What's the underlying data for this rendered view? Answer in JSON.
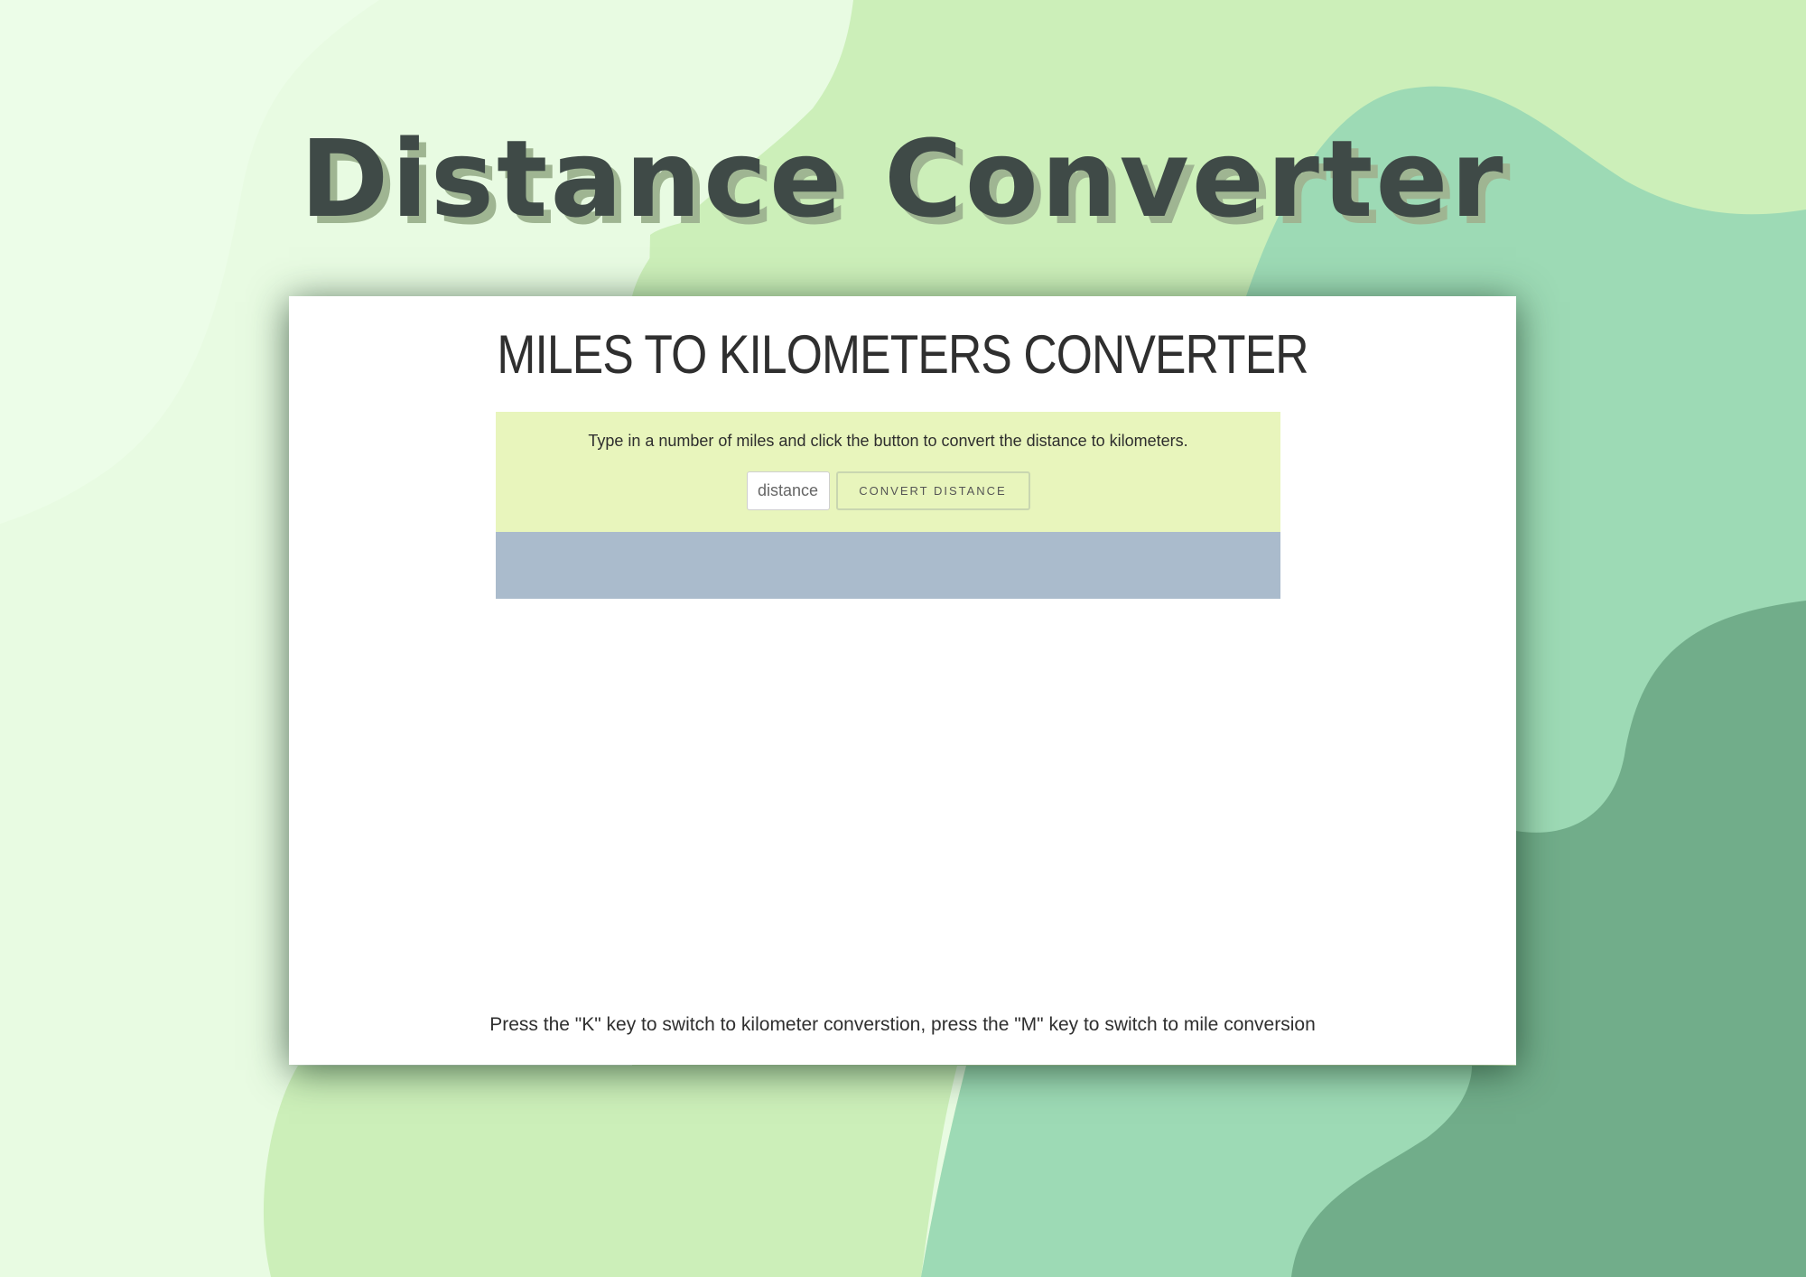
{
  "hero": {
    "title": "Distance Converter"
  },
  "app": {
    "heading": "MILES TO KILOMETERS CONVERTER",
    "instructions": "Type in a number of miles and click the button to convert the distance to kilometers.",
    "input": {
      "placeholder": "distance",
      "value": ""
    },
    "convert_button_label": "CONVERT DISTANCE",
    "result_text": "",
    "footer_hint": "Press the \"K\" key to switch to kilometer converstion, press the \"M\" key to switch to mile conversion"
  },
  "colors": {
    "form_panel": "#e8f5bc",
    "result_panel": "#aabbcc",
    "blob_lightest": "#e8fbe2",
    "blob_light": "#ccefb9",
    "blob_mid": "#9ddab5",
    "blob_dark": "#71ad8a"
  }
}
